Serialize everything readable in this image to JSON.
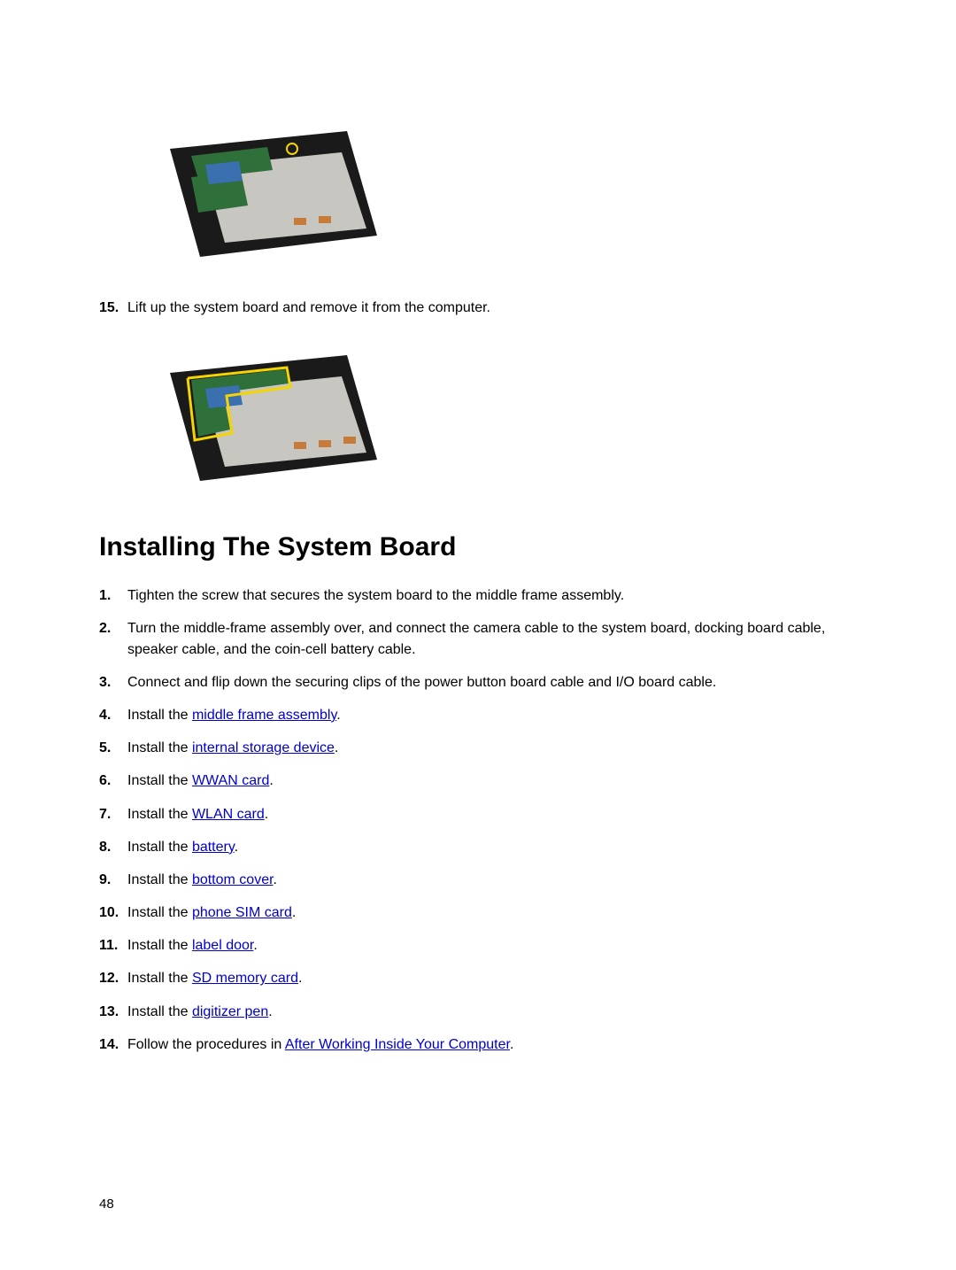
{
  "removal": {
    "step15_num": "15.",
    "step15_text": "Lift up the system board and remove it from the computer."
  },
  "section_heading": "Installing The System Board",
  "install": {
    "s1_num": "1.",
    "s1_text": "Tighten the screw that secures the system board to the middle frame assembly.",
    "s2_num": "2.",
    "s2_text": "Turn the middle-frame assembly over, and connect the camera cable to the system board, docking board cable, speaker cable, and the coin-cell battery cable.",
    "s3_num": "3.",
    "s3_text": "Connect and flip down the securing clips of the power button board cable and I/O board cable.",
    "s4_num": "4.",
    "s4_prefix": "Install the ",
    "s4_link": "middle frame assembly",
    "s4_suffix": ".",
    "s5_num": "5.",
    "s5_prefix": "Install the ",
    "s5_link": "internal storage device",
    "s5_suffix": ".",
    "s6_num": "6.",
    "s6_prefix": "Install the ",
    "s6_link": "WWAN card",
    "s6_suffix": ".",
    "s7_num": "7.",
    "s7_prefix": "Install the ",
    "s7_link": "WLAN card",
    "s7_suffix": ".",
    "s8_num": "8.",
    "s8_prefix": "Install the ",
    "s8_link": "battery",
    "s8_suffix": ".",
    "s9_num": "9.",
    "s9_prefix": "Install the ",
    "s9_link": "bottom cover",
    "s9_suffix": ".",
    "s10_num": "10.",
    "s10_prefix": "Install the ",
    "s10_link": "phone SIM card",
    "s10_suffix": ".",
    "s11_num": "11.",
    "s11_prefix": "Install the ",
    "s11_link": "label door",
    "s11_suffix": ".",
    "s12_num": "12.",
    "s12_prefix": "Install the ",
    "s12_link": "SD memory card",
    "s12_suffix": ".",
    "s13_num": "13.",
    "s13_prefix": "Install the ",
    "s13_link": "digitizer pen",
    "s13_suffix": ".",
    "s14_num": "14.",
    "s14_prefix": "Follow the procedures in ",
    "s14_link": "After Working Inside Your Computer",
    "s14_suffix": "."
  },
  "page_number": "48"
}
